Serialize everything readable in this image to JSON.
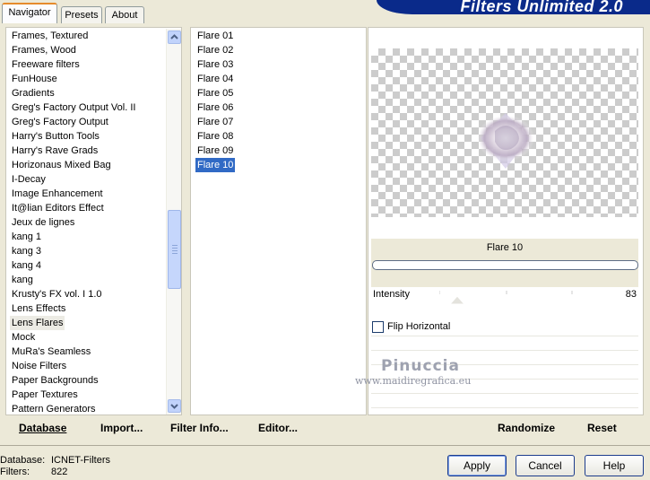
{
  "tabs": [
    {
      "label": "Navigator",
      "active": true
    },
    {
      "label": "Presets",
      "active": false
    },
    {
      "label": "About",
      "active": false
    }
  ],
  "banner_title": "Filters Unlimited 2.0",
  "categories": [
    "Frames, Textured",
    "Frames, Wood",
    "Freeware filters",
    "FunHouse",
    "Gradients",
    "Greg's Factory Output Vol. II",
    "Greg's Factory Output",
    "Harry's Button Tools",
    "Harry's Rave Grads",
    "Horizonaus Mixed Bag",
    "I-Decay",
    "Image Enhancement",
    "It@lian Editors Effect",
    "Jeux de lignes",
    "kang 1",
    "kang 3",
    "kang 4",
    "kang",
    "Krusty's FX vol. I 1.0",
    "Lens Effects",
    "Lens Flares",
    "Mock",
    "MuRa's Seamless",
    "Noise Filters",
    "Paper Backgrounds",
    "Paper Textures",
    "Pattern Generators"
  ],
  "selected_category": "Lens Flares",
  "filters": [
    "Flare 01",
    "Flare 02",
    "Flare 03",
    "Flare 04",
    "Flare 05",
    "Flare 06",
    "Flare 07",
    "Flare 08",
    "Flare 09",
    "Flare 10"
  ],
  "selected_filter": "Flare 10",
  "preview_title": "Flare 10",
  "params": {
    "intensity_label": "Intensity",
    "intensity_value": "83",
    "flip_label": "Flip Horizontal",
    "flip_checked": false
  },
  "watermark": {
    "line1": "Pinuccia",
    "line2": "www.maidiregrafica.eu"
  },
  "bottom_links": {
    "database": "Database",
    "import": "Import...",
    "filter_info": "Filter Info...",
    "editor": "Editor...",
    "randomize": "Randomize",
    "reset": "Reset"
  },
  "status": {
    "database_label": "Database:",
    "database_value": "ICNET-Filters",
    "filters_label": "Filters:",
    "filters_value": "822"
  },
  "buttons": {
    "apply": "Apply",
    "cancel": "Cancel",
    "help": "Help"
  },
  "colors": {
    "selection": "#316ac5",
    "banner": "#0a2a8a",
    "tab_accent": "#e68b2c"
  }
}
